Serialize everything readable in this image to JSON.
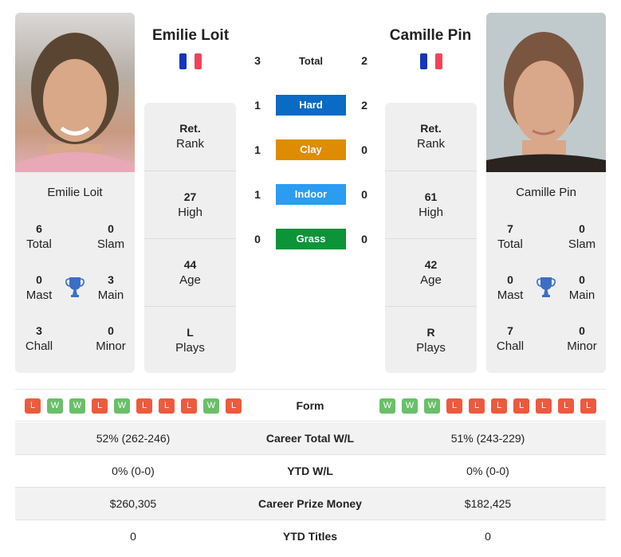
{
  "players": {
    "left": {
      "name": "Emilie Loit",
      "country": "France",
      "flag_icon": "france-flag-icon",
      "titles": {
        "total": {
          "value": "6",
          "label": "Total"
        },
        "slam": {
          "value": "0",
          "label": "Slam"
        },
        "mast": {
          "value": "0",
          "label": "Mast"
        },
        "main": {
          "value": "3",
          "label": "Main"
        },
        "chall": {
          "value": "3",
          "label": "Chall"
        },
        "minor": {
          "value": "0",
          "label": "Minor"
        }
      },
      "info": [
        {
          "value": "Ret.",
          "label": "Rank"
        },
        {
          "value": "27",
          "label": "High"
        },
        {
          "value": "44",
          "label": "Age"
        },
        {
          "value": "L",
          "label": "Plays"
        }
      ],
      "form": [
        "L",
        "W",
        "W",
        "L",
        "W",
        "L",
        "L",
        "L",
        "W",
        "L"
      ]
    },
    "right": {
      "name": "Camille Pin",
      "country": "France",
      "flag_icon": "france-flag-icon",
      "titles": {
        "total": {
          "value": "7",
          "label": "Total"
        },
        "slam": {
          "value": "0",
          "label": "Slam"
        },
        "mast": {
          "value": "0",
          "label": "Mast"
        },
        "main": {
          "value": "0",
          "label": "Main"
        },
        "chall": {
          "value": "7",
          "label": "Chall"
        },
        "minor": {
          "value": "0",
          "label": "Minor"
        }
      },
      "info": [
        {
          "value": "Ret.",
          "label": "Rank"
        },
        {
          "value": "61",
          "label": "High"
        },
        {
          "value": "42",
          "label": "Age"
        },
        {
          "value": "R",
          "label": "Plays"
        }
      ],
      "form": [
        "W",
        "W",
        "W",
        "L",
        "L",
        "L",
        "L",
        "L",
        "L",
        "L"
      ]
    }
  },
  "h2h": {
    "total": {
      "label": "Total",
      "left": "3",
      "right": "2"
    },
    "surfaces": [
      {
        "label": "Hard",
        "left": "1",
        "right": "2",
        "color": "#0a6bc4"
      },
      {
        "label": "Clay",
        "left": "1",
        "right": "0",
        "color": "#de8c00"
      },
      {
        "label": "Indoor",
        "left": "1",
        "right": "0",
        "color": "#2b9cf2"
      },
      {
        "label": "Grass",
        "left": "0",
        "right": "0",
        "color": "#0d9438"
      }
    ]
  },
  "form_label": "Form",
  "stats": [
    {
      "label": "Career Total W/L",
      "left": "52% (262-246)",
      "right": "51% (243-229)"
    },
    {
      "label": "YTD W/L",
      "left": "0% (0-0)",
      "right": "0% (0-0)"
    },
    {
      "label": "Career Prize Money",
      "left": "$260,305",
      "right": "$182,425"
    },
    {
      "label": "YTD Titles",
      "left": "0",
      "right": "0"
    }
  ],
  "colors": {
    "win": "#6abf69",
    "loss": "#ee5a3e",
    "trophy": "#3b6fc4"
  }
}
